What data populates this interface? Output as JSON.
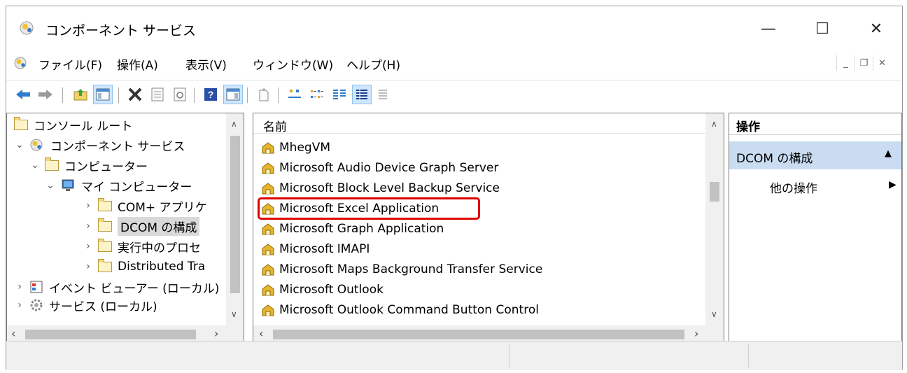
{
  "window": {
    "title": "コンポーネント サービス",
    "minimize": "—",
    "maximize": "☐",
    "close": "✕"
  },
  "menu": {
    "items": [
      "ファイル(F)",
      "操作(A)",
      "表示(V)",
      "ウィンドウ(W)",
      "ヘルプ(H)"
    ]
  },
  "tree": {
    "items": [
      {
        "label": "コンソール ルート"
      },
      {
        "label": "コンポーネント サービス"
      },
      {
        "label": "コンピューター"
      },
      {
        "label": "マイ コンピューター"
      },
      {
        "label": "COM+ アプリケ"
      },
      {
        "label": "DCOM の構成"
      },
      {
        "label": "実行中のプロセ"
      },
      {
        "label": "Distributed Tra"
      },
      {
        "label": "イベント ビューアー (ローカル)"
      },
      {
        "label": "サービス (ローカル)"
      }
    ]
  },
  "list": {
    "column_header": "名前",
    "items": [
      "MhegVM",
      "Microsoft Audio Device Graph Server",
      "Microsoft Block Level Backup Service",
      "Microsoft Excel Application",
      "Microsoft Graph Application",
      "Microsoft IMAPI",
      "Microsoft Maps Background Transfer Service",
      "Microsoft Outlook",
      "Microsoft Outlook Command Button Control"
    ],
    "highlighted": "Microsoft Excel Application",
    "highlight_color": "#e00000"
  },
  "actions": {
    "header": "操作",
    "section": "DCOM の構成",
    "more": "他の操作"
  }
}
